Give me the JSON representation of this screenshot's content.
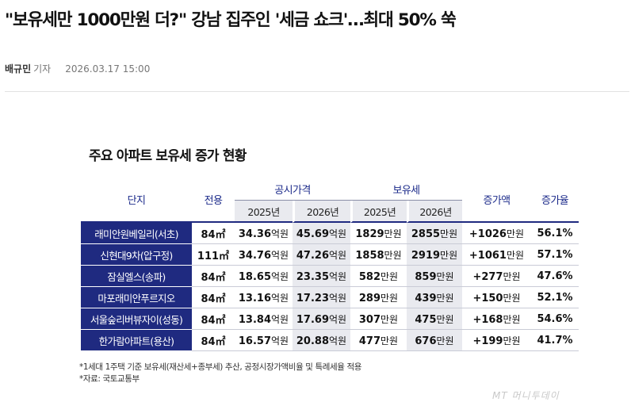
{
  "article": {
    "headline": "\"보유세만 1000만원 더?\" 강남 집주인 '세금 쇼크'…최대 50% 쑥",
    "author": "배규민",
    "role": "기자",
    "datetime": "2026.03.17 15:00"
  },
  "infographic": {
    "title": "주요 아파트 보유세 증가 현황",
    "headers": {
      "complex": "단지",
      "area": "전용",
      "public_price": "공시가격",
      "holding_tax": "보유세",
      "increase_amount": "증가액",
      "increase_rate": "증가율",
      "year_2025": "2025년",
      "year_2026": "2026년"
    },
    "rows": [
      {
        "name": "래미안원베일리(서초)",
        "area": "84㎡",
        "price_2025": "34.36",
        "price_2026": "45.69",
        "tax_2025": "1829",
        "tax_2026": "2855",
        "increase": "+1026",
        "rate": "56.1%"
      },
      {
        "name": "신현대9차(압구정)",
        "area": "111㎡",
        "price_2025": "34.76",
        "price_2026": "47.26",
        "tax_2025": "1858",
        "tax_2026": "2919",
        "increase": "+1061",
        "rate": "57.1%"
      },
      {
        "name": "잠실엘스(송파)",
        "area": "84㎡",
        "price_2025": "18.65",
        "price_2026": "23.35",
        "tax_2025": "582",
        "tax_2026": "859",
        "increase": "+277",
        "rate": "47.6%"
      },
      {
        "name": "마포래미안푸르지오",
        "area": "84㎡",
        "price_2025": "13.16",
        "price_2026": "17.23",
        "tax_2025": "289",
        "tax_2026": "439",
        "increase": "+150",
        "rate": "52.1%"
      },
      {
        "name": "서울숲리버뷰자이(성동)",
        "area": "84㎡",
        "price_2025": "13.84",
        "price_2026": "17.69",
        "tax_2025": "307",
        "tax_2026": "475",
        "increase": "+168",
        "rate": "54.6%"
      },
      {
        "name": "한가람아파트(용산)",
        "area": "84㎡",
        "price_2025": "16.57",
        "price_2026": "20.88",
        "tax_2025": "477",
        "tax_2026": "676",
        "increase": "+199",
        "rate": "41.7%"
      }
    ],
    "units": {
      "price": "억원",
      "tax": "만원"
    },
    "notes": [
      "*1세대 1주택 기준 보유세(재산세+종부세) 추산, 공정시장가액비율 및 특례세율 적용",
      "*자료: 국토교통부"
    ],
    "watermark": "MT 머니투데이"
  },
  "colors": {
    "name_cell_bg": "#1f2a80",
    "header_text": "#1b2a8a",
    "shade": "#e9eaef"
  }
}
